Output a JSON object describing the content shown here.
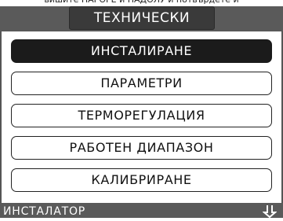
{
  "top_caption": "вишите НАГОРЕ и НАДОЛУ и потвърдете и",
  "header": {
    "title": "ТЕХНИЧЕСКИ"
  },
  "menu": {
    "items": [
      {
        "label": "ИНСТАЛИРАНЕ",
        "selected": true
      },
      {
        "label": "ПАРАМЕТРИ",
        "selected": false
      },
      {
        "label": "ТЕРМОРЕГУЛАЦИЯ",
        "selected": false
      },
      {
        "label": "РАБОТЕН ДИАПАЗОН",
        "selected": false
      },
      {
        "label": "КАЛИБРИРАНЕ",
        "selected": false
      }
    ]
  },
  "footer": {
    "label": "ИНСТАЛАТОР",
    "icon": "return-arrow-icon"
  },
  "colors": {
    "band": "#5a5a5a",
    "title_box": "#3a3a3a",
    "selected_item": "#1b1b1b"
  }
}
